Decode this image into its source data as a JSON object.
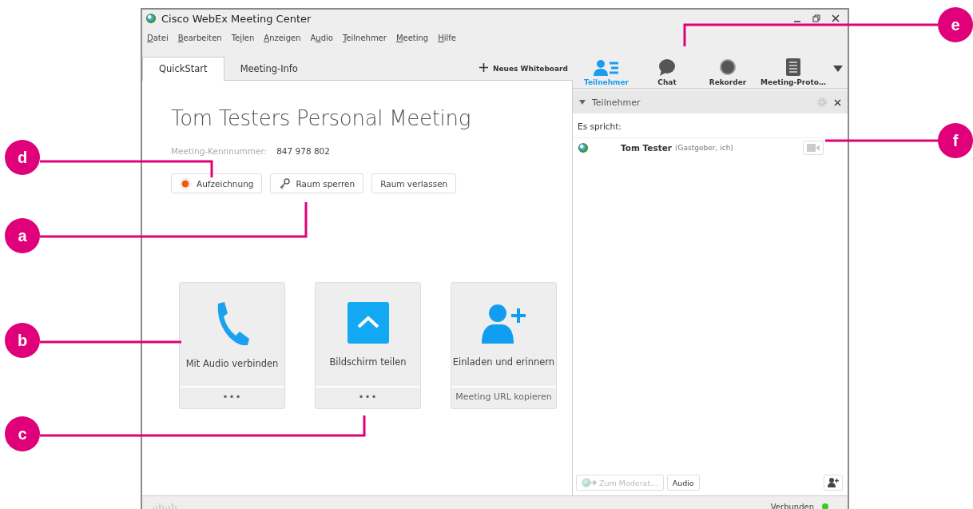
{
  "window": {
    "title": "Cisco WebEx Meeting Center"
  },
  "menu": [
    {
      "key": "D",
      "post": "atei"
    },
    {
      "key": "B",
      "post": "earbeiten"
    },
    {
      "pre": "Te",
      "key": "i",
      "post": "len"
    },
    {
      "key": "A",
      "post": "nzeigen"
    },
    {
      "pre": "A",
      "key": "u",
      "post": "dio"
    },
    {
      "key": "T",
      "post": "eilnehmer"
    },
    {
      "key": "M",
      "post": "eeting"
    },
    {
      "key": "H",
      "post": "ilfe"
    }
  ],
  "tabs": [
    {
      "label": "QuickStart",
      "selected": true
    },
    {
      "label": "Meeting-Info",
      "selected": false
    }
  ],
  "whiteboard_button": "Neues Whiteboard",
  "meeting": {
    "title": "Tom Testers Personal Meeting",
    "number_label": "Meeting-Kennnummer:",
    "number": "847 978 802",
    "buttons": [
      {
        "kind": "record",
        "label": "Aufzeichnung"
      },
      {
        "kind": "lock",
        "label": "Raum sperren"
      },
      {
        "kind": "plain",
        "label": "Raum verlassen"
      }
    ]
  },
  "tiles": [
    {
      "kind": "phone",
      "label": "Mit Audio verbinden",
      "footer": "•••"
    },
    {
      "kind": "share",
      "label": "Bildschirm teilen",
      "footer": "•••"
    },
    {
      "kind": "invite",
      "label": "Einladen und erinnern",
      "footer": "Meeting URL kopieren"
    }
  ],
  "toolbar": [
    {
      "kind": "people",
      "label": "Teilnehmer",
      "selected": true
    },
    {
      "kind": "chat",
      "label": "Chat",
      "selected": false
    },
    {
      "kind": "record",
      "label": "Rekorder",
      "selected": false
    },
    {
      "kind": "notes",
      "label": "Meeting-Proto…",
      "selected": false
    }
  ],
  "panel": {
    "title": "Teilnehmer",
    "expanded": true,
    "speaking_label": "Es spricht:",
    "participants": [
      {
        "name": "Tom Tester",
        "role": "(Gastgeber, ich)"
      }
    ],
    "footer_buttons": [
      {
        "label": "Zum Moderat…",
        "disabled": true
      },
      {
        "label": "Audio",
        "disabled": false
      }
    ]
  },
  "status_bar": {
    "text": "Verbunden",
    "color": "#33cc22"
  },
  "callouts": [
    {
      "letter": "d"
    },
    {
      "letter": "a"
    },
    {
      "letter": "b"
    },
    {
      "letter": "c"
    },
    {
      "letter": "e"
    },
    {
      "letter": "f"
    }
  ]
}
